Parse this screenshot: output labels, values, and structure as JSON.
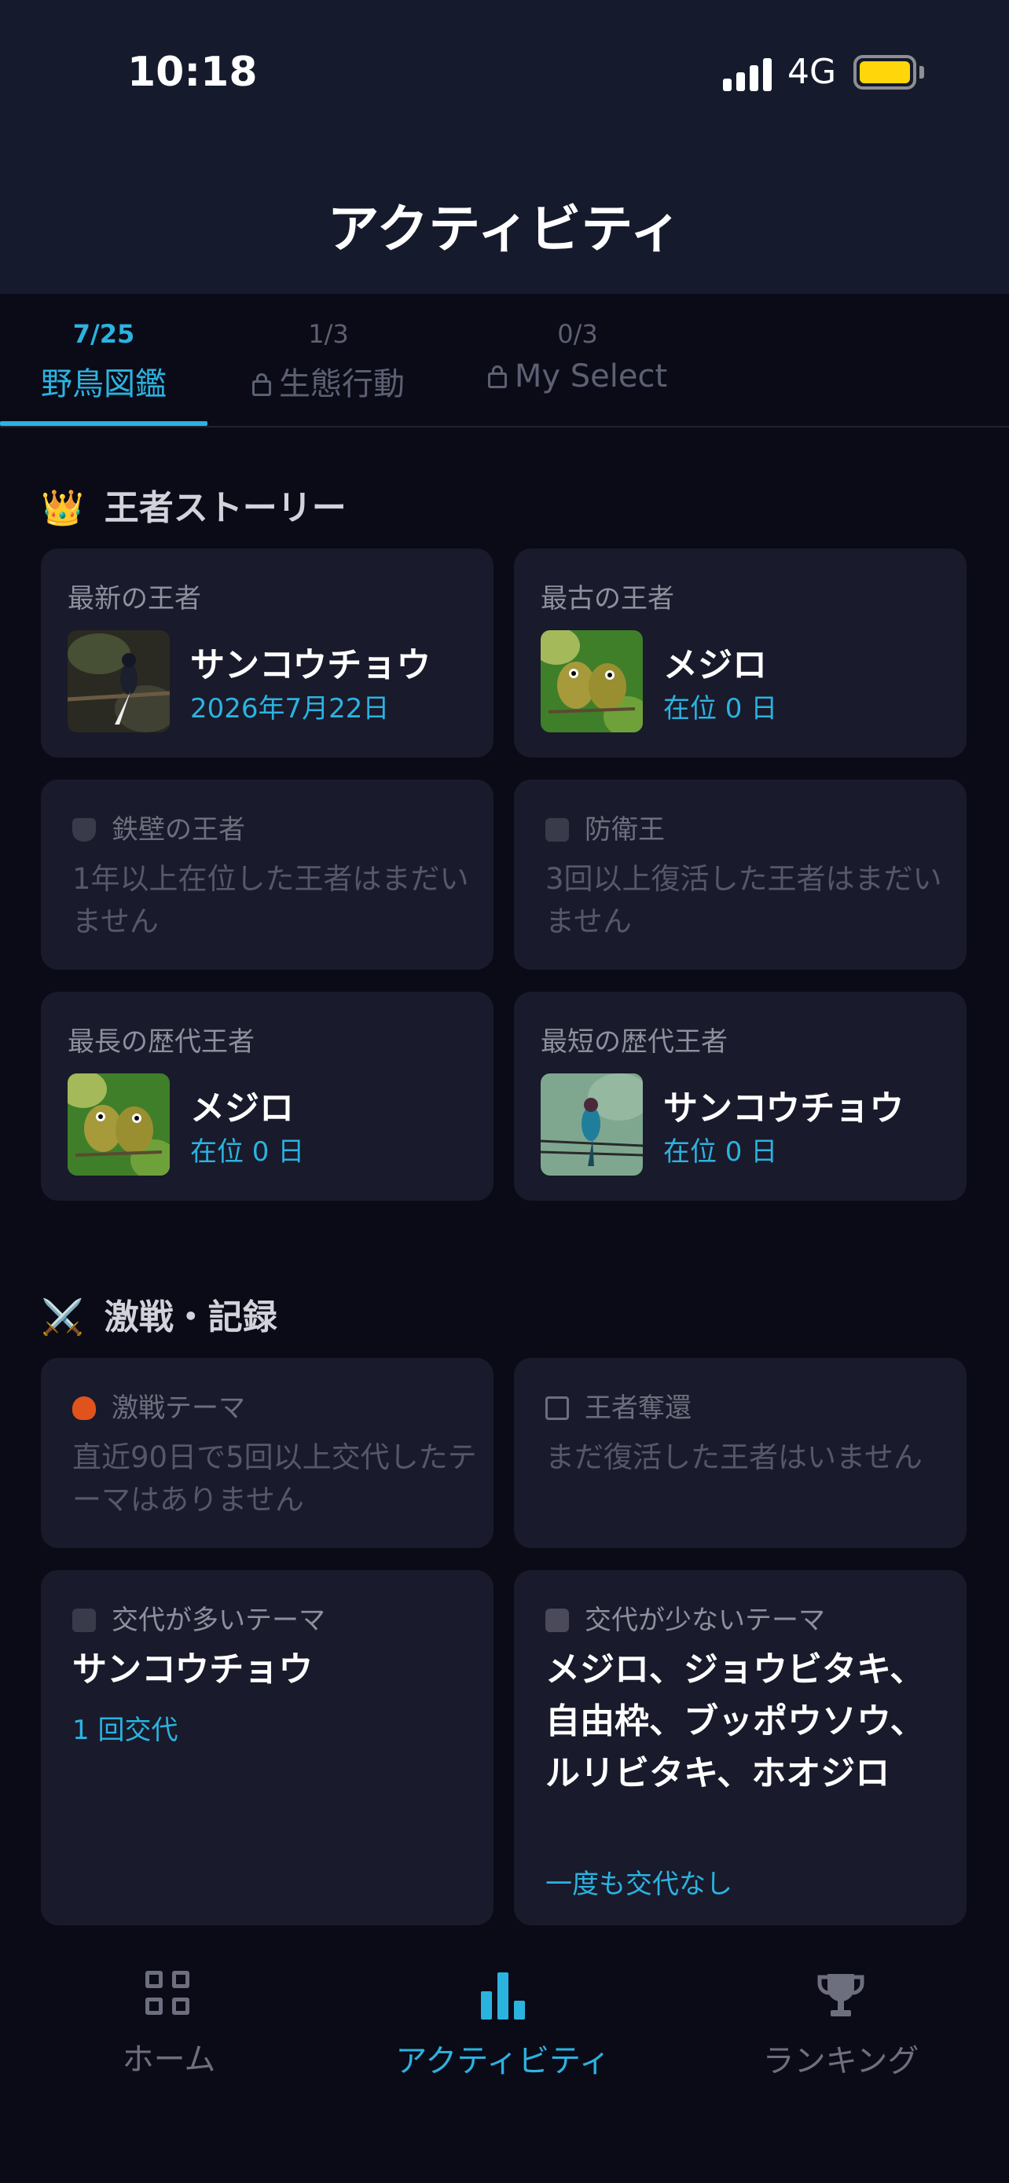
{
  "status_bar": {
    "time": "10:18",
    "network": "4G"
  },
  "header": {
    "title": "アクティビティ"
  },
  "tabs": [
    {
      "count": "7/25",
      "label": "野鳥図鑑",
      "locked": false,
      "active": true
    },
    {
      "count": "1/3",
      "label": "生態行動",
      "locked": true,
      "active": false
    },
    {
      "count": "0/3",
      "label": "My Select",
      "locked": true,
      "active": false
    }
  ],
  "story": {
    "title": "王者ストーリー",
    "icon": "crown-icon",
    "newest": {
      "label": "最新の王者",
      "name": "サンコウチョウ",
      "sub": "2026年7月22日"
    },
    "oldest": {
      "label": "最古の王者",
      "name": "メジロ",
      "sub": "在位 0 日"
    },
    "iron_wall": {
      "label": "鉄壁の王者",
      "empty": "1年以上在位した王者はまだいません"
    },
    "defender": {
      "label": "防衛王",
      "empty": "3回以上復活した王者はまだいません"
    },
    "longest": {
      "label": "最長の歴代王者",
      "name": "メジロ",
      "sub": "在位 0 日"
    },
    "shortest": {
      "label": "最短の歴代王者",
      "name": "サンコウチョウ",
      "sub": "在位 0 日"
    }
  },
  "battle": {
    "title": "激戦・記録",
    "icon": "crossed-swords-icon",
    "hot_theme": {
      "label": "激戦テーマ",
      "empty": "直近90日で5回以上交代したテーマはありません"
    },
    "reclaim": {
      "label": "王者奪還",
      "empty": "まだ復活した王者はいません"
    },
    "most_changes": {
      "label": "交代が多いテーマ",
      "name": "サンコウチョウ",
      "sub": "1 回交代"
    },
    "fewest_changes": {
      "label": "交代が少ないテーマ",
      "name": "メジロ、ジョウビタキ、自由枠、ブッポウソウ、ルリビタキ、ホオジロ",
      "sub": "一度も交代なし"
    }
  },
  "bottom_nav": [
    {
      "label": "ホーム",
      "icon": "grid-icon",
      "active": false
    },
    {
      "label": "アクティビティ",
      "icon": "bar-chart-icon",
      "active": true
    },
    {
      "label": "ランキング",
      "icon": "trophy-icon",
      "active": false
    }
  ],
  "colors": {
    "accent": "#2bb3e0",
    "background": "#0b0b18",
    "card": "#191a2b",
    "header": "#151a2c",
    "battery": "#ffd60a"
  }
}
